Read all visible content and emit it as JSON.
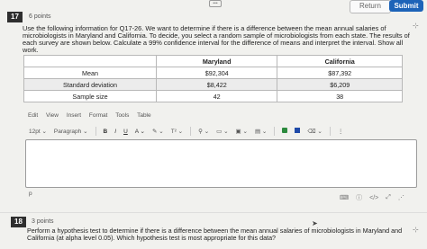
{
  "header": {
    "ellipsis": "•••",
    "return_label": "Return",
    "submit_label": "Submit"
  },
  "q17": {
    "number": "17",
    "points": "6 points",
    "text": "Use the following information for Q17-26. We want to determine if there is a difference between the mean annual salaries of microbiologists in Maryland and California. To decide, you select a random sample of microbiologists from each state. The results of each survey are shown below. Calculate a 99% confidence interval for the difference of means and interpret the interval. Show all work.",
    "table": {
      "headers": [
        "",
        "Maryland",
        "California"
      ],
      "rows": [
        [
          "Mean",
          "$92,304",
          "$87,392"
        ],
        [
          "Standard deviation",
          "$8,422",
          "$6,209"
        ],
        [
          "Sample size",
          "42",
          "38"
        ]
      ]
    }
  },
  "editor": {
    "menu": [
      "Edit",
      "View",
      "Insert",
      "Format",
      "Tools",
      "Table"
    ],
    "font_size": "12pt",
    "paragraph": "Paragraph",
    "bold": "B",
    "italic": "I",
    "underline": "U",
    "text_color": "A",
    "superscript": "T²",
    "status": "p",
    "more": "⋮"
  },
  "q18": {
    "number": "18",
    "points": "3 points",
    "text": "Perform a hypothesis test to determine if there is a difference between the mean annual salaries of microbiologists in Maryland and California (at alpha level 0.05). Which hypothesis test is most appropriate for this data?"
  }
}
